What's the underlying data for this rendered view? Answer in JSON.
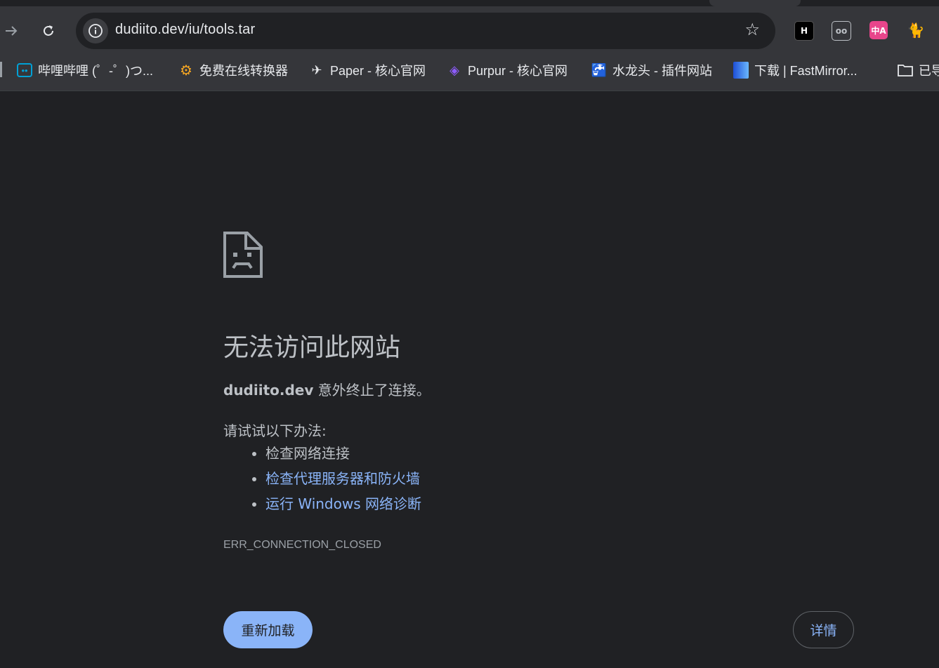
{
  "toolbar": {
    "forward_icon": "arrow-right-icon",
    "reload_icon": "reload-icon",
    "url": "dudiito.dev/iu/tools.tar",
    "bookmark_star_icon": "star-icon",
    "extensions": [
      {
        "name": "h-extension-icon",
        "label": "H",
        "color": "#000000"
      },
      {
        "name": "eyes-extension-icon",
        "label": "oo",
        "color": "#35363a"
      },
      {
        "name": "translate-extension-icon",
        "label": "中A",
        "color": "#e8458b"
      },
      {
        "name": "cat-extension-icon",
        "label": "🐈",
        "color": "#35363a"
      }
    ]
  },
  "bookmarks": [
    {
      "label": "哔哩哔哩 (゜-゜)つ...",
      "icon": "bilibili-icon",
      "color": "#00a1d6"
    },
    {
      "label": "免费在线转换器",
      "icon": "gear-icon",
      "color": "#f5a623"
    },
    {
      "label": "Paper - 核心官网",
      "icon": "paper-plane-icon",
      "color": "#e8eaed"
    },
    {
      "label": "Purpur - 核心官网",
      "icon": "purpur-cube-icon",
      "color": "#8e5cff"
    },
    {
      "label": "水龙头 - 插件网站",
      "icon": "faucet-icon",
      "color": "#f5d000"
    },
    {
      "label": "下载 | FastMirror...",
      "icon": "fastmirror-book-icon",
      "color": "#3b8cff"
    },
    {
      "label": "已导",
      "icon": "folder-icon",
      "color": "#e8eaed"
    }
  ],
  "error_page": {
    "heading": "无法访问此网站",
    "domain": "dudiito.dev",
    "message_rest": " 意外终止了连接。",
    "try_label": "请试试以下办法:",
    "suggestions": {
      "s1": "检查网络连接",
      "s2": "检查代理服务器和防火墙",
      "s3": "运行 Windows 网络诊断"
    },
    "error_code": "ERR_CONNECTION_CLOSED",
    "reload_label": "重新加载",
    "details_label": "详情"
  }
}
